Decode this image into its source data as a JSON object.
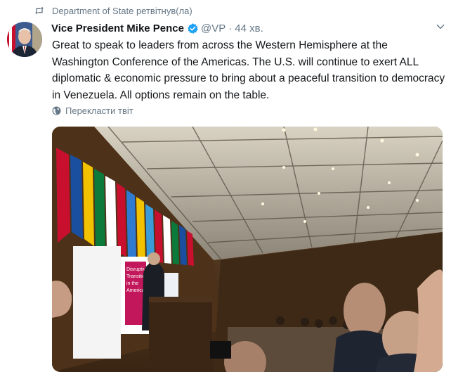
{
  "retweet": {
    "text": "Department of State ретвітнув(ла)",
    "icon": "retweet-icon"
  },
  "tweet": {
    "author_name": "Vice President Mike Pence",
    "handle": "@VP",
    "separator": "·",
    "time": "44 хв.",
    "text": "Great to speak to leaders from across the Western Hemisphere at the Washington Conference of the Americas. The U.S. will continue to exert ALL diplomatic & economic pressure to bring about a peaceful transition to democracy in Venezuela. All options remain on the table.",
    "translate_label": "Перекласти твіт"
  },
  "media": {
    "podium_sign": [
      "Disruptive",
      "Transition",
      "in the",
      "Americas"
    ]
  },
  "colors": {
    "text_primary": "#14171a",
    "text_secondary": "#657786",
    "verified": "#1da1f2"
  }
}
